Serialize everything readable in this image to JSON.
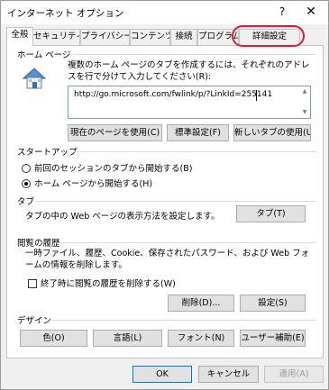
{
  "window": {
    "title": "インターネット オプション",
    "help_label": "?",
    "close_label": "✕"
  },
  "tabs": [
    {
      "label": "全般",
      "active": true
    },
    {
      "label": "セキュリティ",
      "active": false
    },
    {
      "label": "プライバシー",
      "active": false
    },
    {
      "label": "コンテンツ",
      "active": false
    },
    {
      "label": "接続",
      "active": false
    },
    {
      "label": "プログラム",
      "active": false
    },
    {
      "label": "詳細設定",
      "active": false
    }
  ],
  "homepage": {
    "heading": "ホーム ページ",
    "description": "複数のホーム ページのタブを作成するには、それぞれのアドレスを行で分けて入力してください(R):",
    "url": "http://go.microsoft.com/fwlink/p/?LinkId=255141",
    "use_current_label": "現在のページを使用(C)",
    "use_default_label": "標準設定(F)",
    "use_new_tab_label": "新しいタブの使用(U)"
  },
  "startup": {
    "heading": "スタートアップ",
    "option_previous": "前回のセッションのタブから開始する(B)",
    "option_home": "ホーム ページから開始する(H)",
    "selected": "home"
  },
  "tabs_section": {
    "heading": "タブ",
    "description": "タブの中の Web ページの表示方法を設定します。",
    "tabs_button_label": "タブ(T)"
  },
  "history": {
    "heading": "閲覧の履歴",
    "description": "一時ファイル、履歴、Cookie、保存されたパスワード、および Web フォームの情報を削除します。",
    "delete_on_exit_label": "終了時に閲覧の履歴を削除する(W)",
    "delete_on_exit_checked": false,
    "delete_button_label": "削除(D)...",
    "settings_button_label": "設定(S)"
  },
  "appearance": {
    "heading": "デザイン",
    "colors_label": "色(O)",
    "languages_label": "言語(L)",
    "fonts_label": "フォント(N)",
    "accessibility_label": "ユーザー補助(E)"
  },
  "footer": {
    "ok_label": "OK",
    "cancel_label": "キャンセル",
    "apply_label": "適用(A)"
  },
  "colors": {
    "highlight": "#e0193a",
    "focus": "#0078d7"
  }
}
